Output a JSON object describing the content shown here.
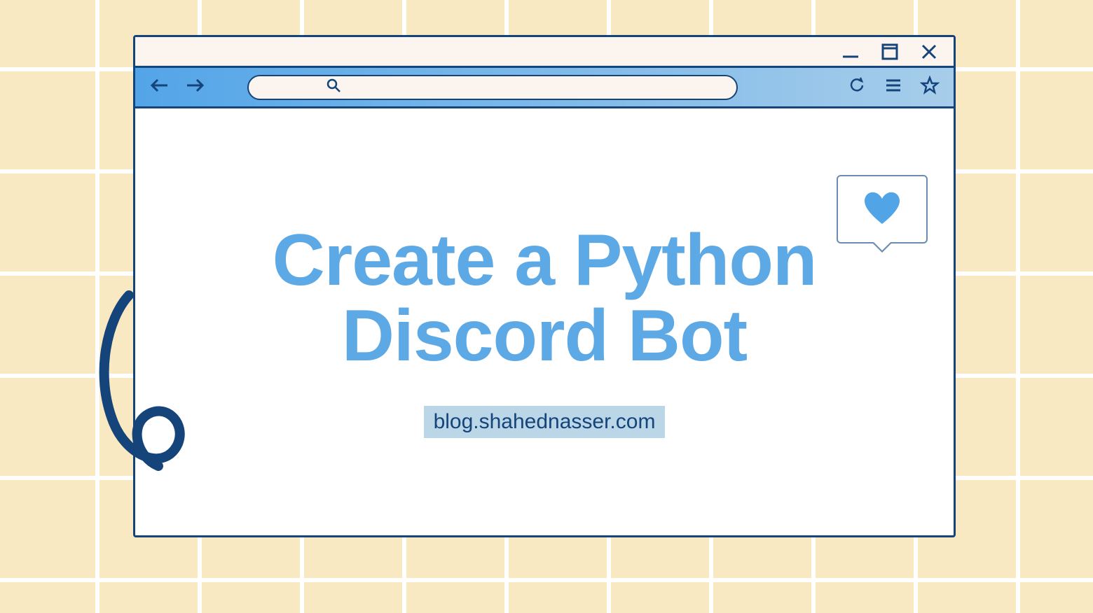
{
  "content": {
    "heading": "Create a Python Discord Bot",
    "url": "blog.shahednasser.com"
  },
  "icons": {
    "minimize": "minimize-icon",
    "maximize": "maximize-icon",
    "close": "close-icon",
    "back": "arrow-left-icon",
    "forward": "arrow-right-icon",
    "search": "search-icon",
    "refresh": "refresh-icon",
    "menu": "menu-icon",
    "star": "star-icon",
    "heart": "heart-icon"
  },
  "colors": {
    "background": "#f8e9c3",
    "border": "#14447a",
    "toolbar_gradient_from": "#53a5e8",
    "toolbar_gradient_to": "#a7cdea",
    "heading": "#5ca9e6",
    "badge_bg": "#bbd6e6"
  }
}
